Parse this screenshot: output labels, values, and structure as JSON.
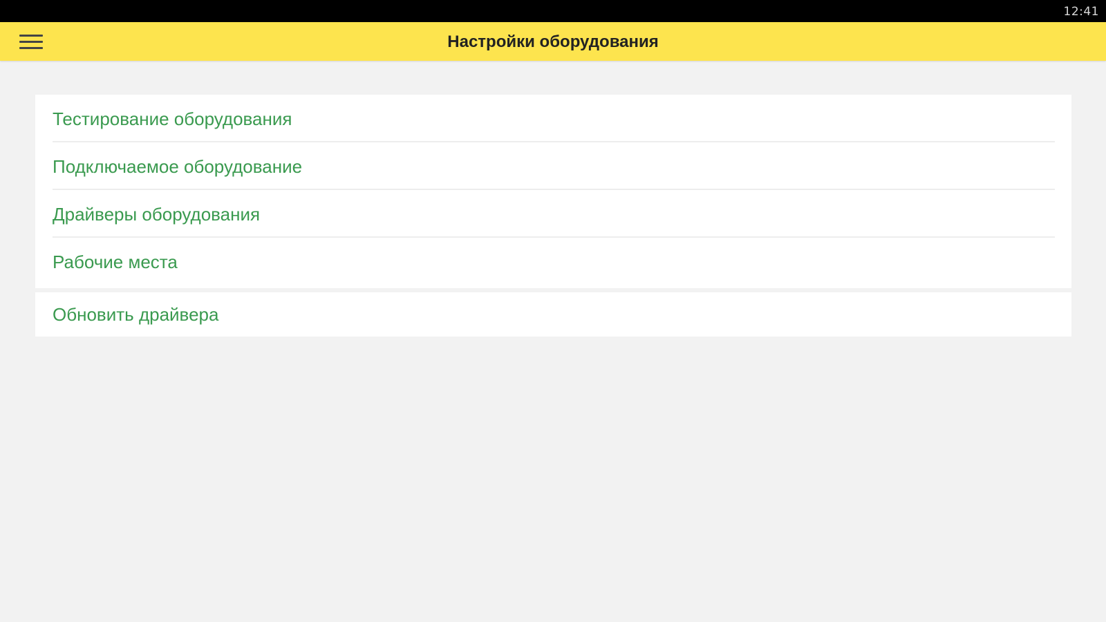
{
  "status_bar": {
    "time": "12:41"
  },
  "app_bar": {
    "title": "Настройки оборудования",
    "menu_icon": "hamburger-menu-icon",
    "background_color": "#fde44e"
  },
  "settings_menu": {
    "items": [
      {
        "label": "Тестирование оборудования"
      },
      {
        "label": "Подключаемое оборудование"
      },
      {
        "label": "Драйверы оборудования"
      },
      {
        "label": "Рабочие места"
      }
    ],
    "update_item": {
      "label": "Обновить драйвера"
    },
    "item_text_color": "#3a9a4f"
  }
}
